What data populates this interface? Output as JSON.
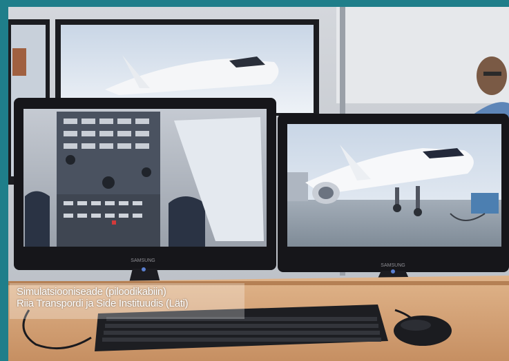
{
  "caption": {
    "line1": "Simulatsiooniseade (piloodikabiin)",
    "line2": "Riia Transpordi ja Side Instituudis (Läti)"
  },
  "colors": {
    "frame": "#1f7e8a",
    "wall": "#c9ccd1",
    "desk": "#d9a77c",
    "monitor": "#16161a",
    "sky": "#dfe7f0",
    "tarmac": "#8f9aa6"
  },
  "monitor_brand": "SAMSUNG"
}
